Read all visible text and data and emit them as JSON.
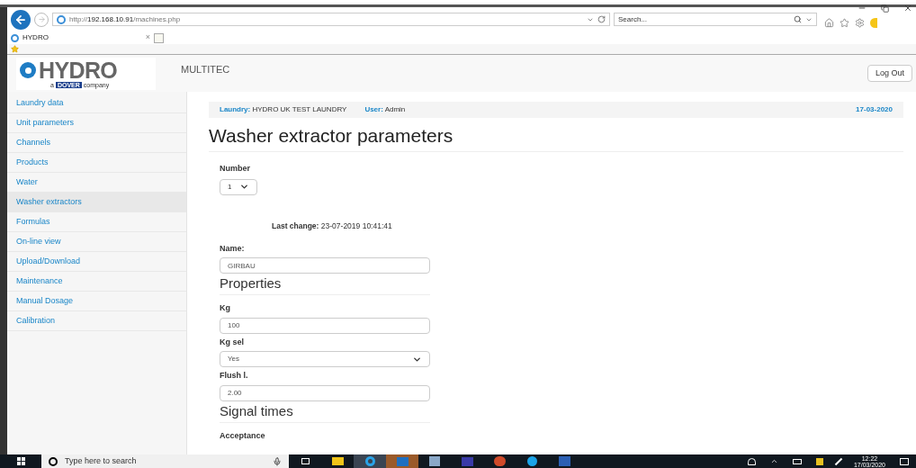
{
  "browser": {
    "url_prefix": "http://",
    "url_host": "192.168.10.91",
    "url_path": "/machines.php",
    "search_placeholder": "Search...",
    "tab_title": "HYDRO",
    "tab_close": "×"
  },
  "header": {
    "brand": "HYDRO",
    "tagline_pre": "a",
    "tagline_brand": "DOVER",
    "tagline_post": "company",
    "product": "MULTITEC",
    "logout": "Log Out"
  },
  "sidebar": {
    "items": [
      {
        "label": "Laundry data",
        "selected": false
      },
      {
        "label": "Unit parameters",
        "selected": false
      },
      {
        "label": "Channels",
        "selected": false
      },
      {
        "label": "Products",
        "selected": false
      },
      {
        "label": "Water",
        "selected": false
      },
      {
        "label": "Washer extractors",
        "selected": true
      },
      {
        "label": "Formulas",
        "selected": false
      },
      {
        "label": "On-line view",
        "selected": false
      },
      {
        "label": "Upload/Download",
        "selected": false
      },
      {
        "label": "Maintenance",
        "selected": false
      },
      {
        "label": "Manual Dosage",
        "selected": false
      },
      {
        "label": "Calibration",
        "selected": false
      }
    ]
  },
  "info_bar": {
    "laundry_label": "Laundry:",
    "laundry_value": "HYDRO UK TEST LAUNDRY",
    "user_label": "User:",
    "user_value": "Admin",
    "date": "17-03-2020"
  },
  "title": "Washer extractor parameters",
  "number": {
    "label": "Number",
    "value": "1"
  },
  "last_change": {
    "label": "Last change:",
    "value": "23-07-2019 10:41:41"
  },
  "form": [
    {
      "kind": "text",
      "label": "Name:",
      "value": "GIRBAU"
    },
    {
      "kind": "heading",
      "label": "Properties"
    },
    {
      "kind": "text",
      "label": "Kg",
      "value": "100"
    },
    {
      "kind": "select",
      "label": "Kg sel",
      "value": "Yes"
    },
    {
      "kind": "text",
      "label": "Flush l.",
      "value": "2.00"
    },
    {
      "kind": "heading",
      "label": "Signal times"
    },
    {
      "kind": "label",
      "label": "Acceptance"
    }
  ],
  "taskbar": {
    "search_placeholder": "Type here to search",
    "time": "12:22",
    "date": "17/03/2020"
  }
}
